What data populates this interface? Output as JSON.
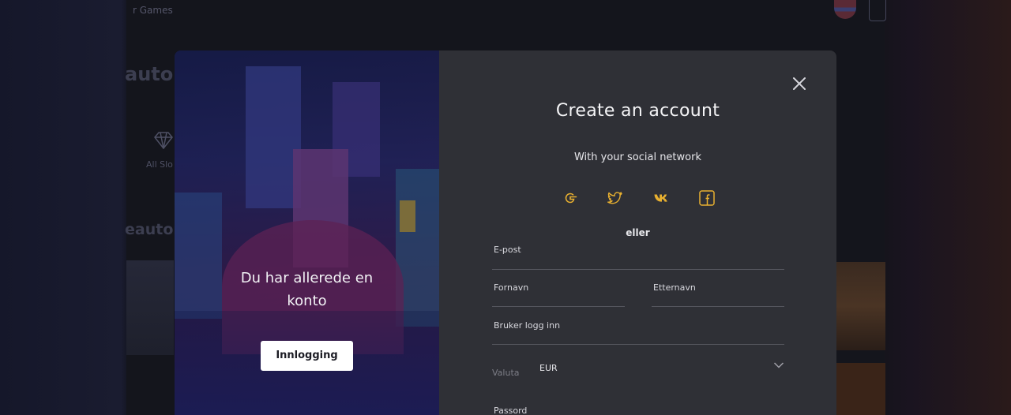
{
  "background": {
    "topbar_text": "r Games",
    "heading": "autor",
    "heading2": "eautom",
    "all_slots": "All Slo"
  },
  "login_panel": {
    "title": "Du har allerede en konto",
    "login_button": "Innlogging"
  },
  "register": {
    "title": "Create an account",
    "social_subtitle": "With your social network",
    "socials": [
      {
        "icon": "google-icon"
      },
      {
        "icon": "twitter-icon"
      },
      {
        "icon": "vk-icon"
      },
      {
        "icon": "facebook-icon"
      }
    ],
    "or": "eller",
    "fields": {
      "email": "E-post",
      "first_name": "Fornavn",
      "last_name": "Etternavn",
      "username": "Bruker logg inn",
      "currency_label": "Valuta",
      "currency_value": "EUR",
      "password": "Passord"
    }
  },
  "colors": {
    "accent": "#e8b030",
    "modal_bg": "#2f3036"
  }
}
